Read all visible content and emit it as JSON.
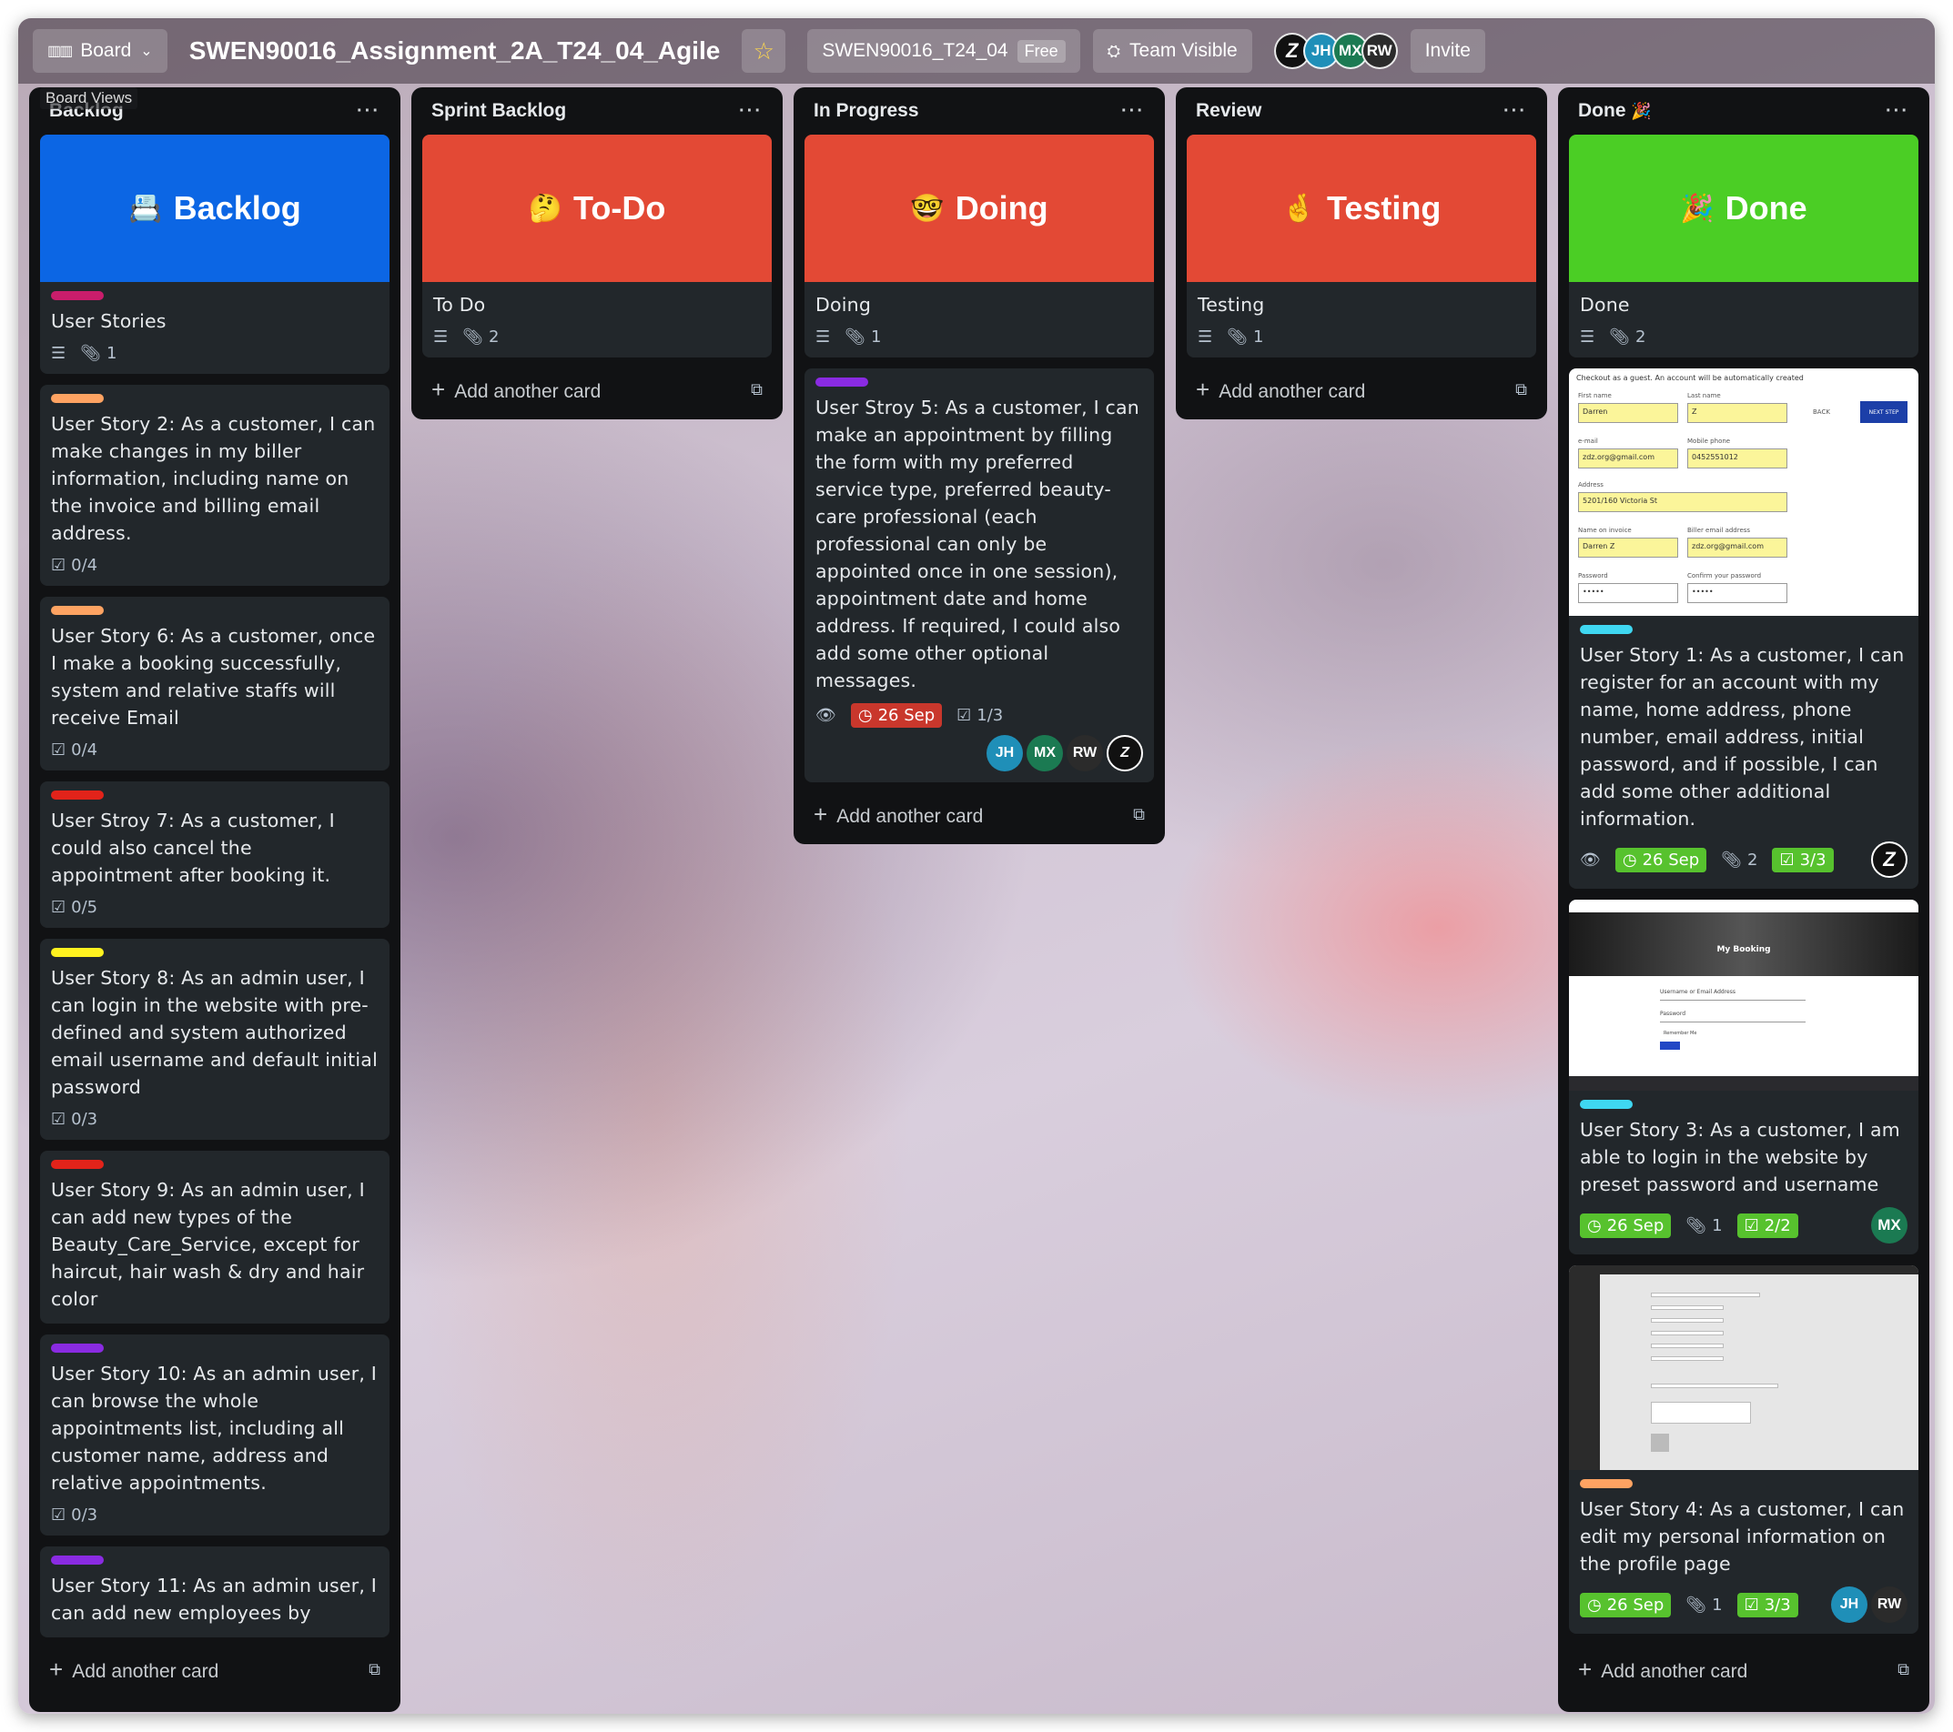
{
  "topbar": {
    "view_label": "Board",
    "board_title": "SWEN90016_Assignment_2A_T24_04_Agile",
    "workspace_name": "SWEN90016_T24_04",
    "workspace_plan": "Free",
    "visibility": "Team Visible",
    "invite_label": "Invite",
    "board_views_tooltip": "Board Views",
    "members": [
      "JH",
      "MX",
      "RW"
    ]
  },
  "lists": [
    {
      "title": "Backlog",
      "cover": {
        "emoji": "📇",
        "text": "Backlog",
        "color": "#0c66e4"
      },
      "cover_card": {
        "title": "User Stories",
        "attachments": "1",
        "label_color": "#c91d6b"
      },
      "cards": [
        {
          "label_color": "#fea362",
          "title": "User Story 2: As a customer, I can make changes in my biller information, including name on the invoice and billing email address.",
          "checklist": "0/4"
        },
        {
          "label_color": "#fea362",
          "title": "User Story 6: As a customer, once I make a booking successfully, system and relative staffs will receive Email",
          "checklist": "0/4"
        },
        {
          "label_color": "#e2231a",
          "title": "User Stroy 7: As a customer, I could also cancel the appointment after booking it.",
          "checklist": "0/5"
        },
        {
          "label_color": "#fff21f",
          "title": "User Story 8: As an admin user, I can login in the website with pre-defined and system authorized email username and default initial password",
          "checklist": "0/3"
        },
        {
          "label_color": "#e2231a",
          "title": "User Story 9: As an admin user, I can add new types of the Beauty_Care_Service, except for haircut, hair wash & dry and hair color",
          "checklist": ""
        },
        {
          "label_color": "#8a2be2",
          "title": "User Story 10: As an admin user, I can browse the whole appointments list, including all customer name, address and relative appointments.",
          "checklist": "0/3"
        },
        {
          "label_color": "#8a2be2",
          "title": "User Story 11: As an admin user, I can add new employees by",
          "checklist": ""
        }
      ],
      "add_label": "Add another card"
    },
    {
      "title": "Sprint Backlog",
      "cover": {
        "emoji": "🤔",
        "text": "To-Do",
        "color": "#e34935"
      },
      "cover_card": {
        "title": "To Do",
        "attachments": "2"
      },
      "add_label": "Add another card"
    },
    {
      "title": "In Progress",
      "cover": {
        "emoji": "🤓",
        "text": "Doing",
        "color": "#e34935"
      },
      "cover_card": {
        "title": "Doing",
        "attachments": "1"
      },
      "cards": [
        {
          "label_color": "#8a2be2",
          "title": "User Stroy 5: As a customer, I can make an appointment by filling the form with my preferred service type, preferred beauty-care professional (each professional can only be appointed once in one session), appointment date and home address. If required, I could also add some other optional messages.",
          "due": "26 Sep",
          "checklist": "1/3",
          "members": [
            "JH",
            "MX",
            "RW"
          ]
        }
      ],
      "add_label": "Add another card"
    },
    {
      "title": "Review",
      "cover": {
        "emoji": "🤞",
        "text": "Testing",
        "color": "#e34935"
      },
      "cover_card": {
        "title": "Testing",
        "attachments": "1"
      },
      "add_label": "Add another card"
    },
    {
      "title": "Done",
      "title_emoji": "🎉",
      "cover": {
        "emoji": "🎉",
        "text": "Done",
        "color": "#4bce25"
      },
      "cover_card": {
        "title": "Done",
        "attachments": "2"
      },
      "cards": [
        {
          "label_color": "#3fd7f1",
          "title": "User Story 1: As a customer, I can register for an account with my name, home address, phone number, email address, initial password, and if possible, I can add some other additional information.",
          "due": "26 Sep",
          "attachments": "2",
          "checklist": "3/3"
        },
        {
          "label_color": "#3fd7f1",
          "title": "User Story 3: As a customer, I am able to login in the website by preset password and username",
          "due": "26 Sep",
          "attachments": "1",
          "checklist": "2/2",
          "members": [
            "MX"
          ]
        },
        {
          "label_color": "#fea362",
          "title": "User Story 4: As a customer, I can edit my personal information on the profile page",
          "due": "26 Sep",
          "attachments": "1",
          "checklist": "3/3",
          "members": [
            "JH",
            "RW"
          ]
        }
      ],
      "add_label": "Add another card"
    }
  ],
  "thumbnails": {
    "register": {
      "heading": "Checkout as a guest. An account will be automatically created",
      "first_name_label": "First name",
      "first_name": "Darren",
      "last_name_label": "Last name",
      "last_name": "Z",
      "back": "BACK",
      "next": "NEXT STEP",
      "email_label": "e-mail",
      "email": "zdz.org@gmail.com",
      "phone_label": "Mobile phone",
      "phone": "0452551012",
      "address_label": "Address",
      "address": "5201/160 Victoria St",
      "invoice_label": "Name on invoice",
      "invoice_name": "Darren Z",
      "biller_label": "Biller email address",
      "biller_email": "zdz.org@gmail.com",
      "password_label": "Password",
      "confirm_label": "Confirm your password",
      "password_mask": "•••••"
    },
    "login": {
      "heading": "My Booking",
      "username_label": "Username or Email Address",
      "password_label": "Password",
      "remember": "Remember Me"
    }
  }
}
